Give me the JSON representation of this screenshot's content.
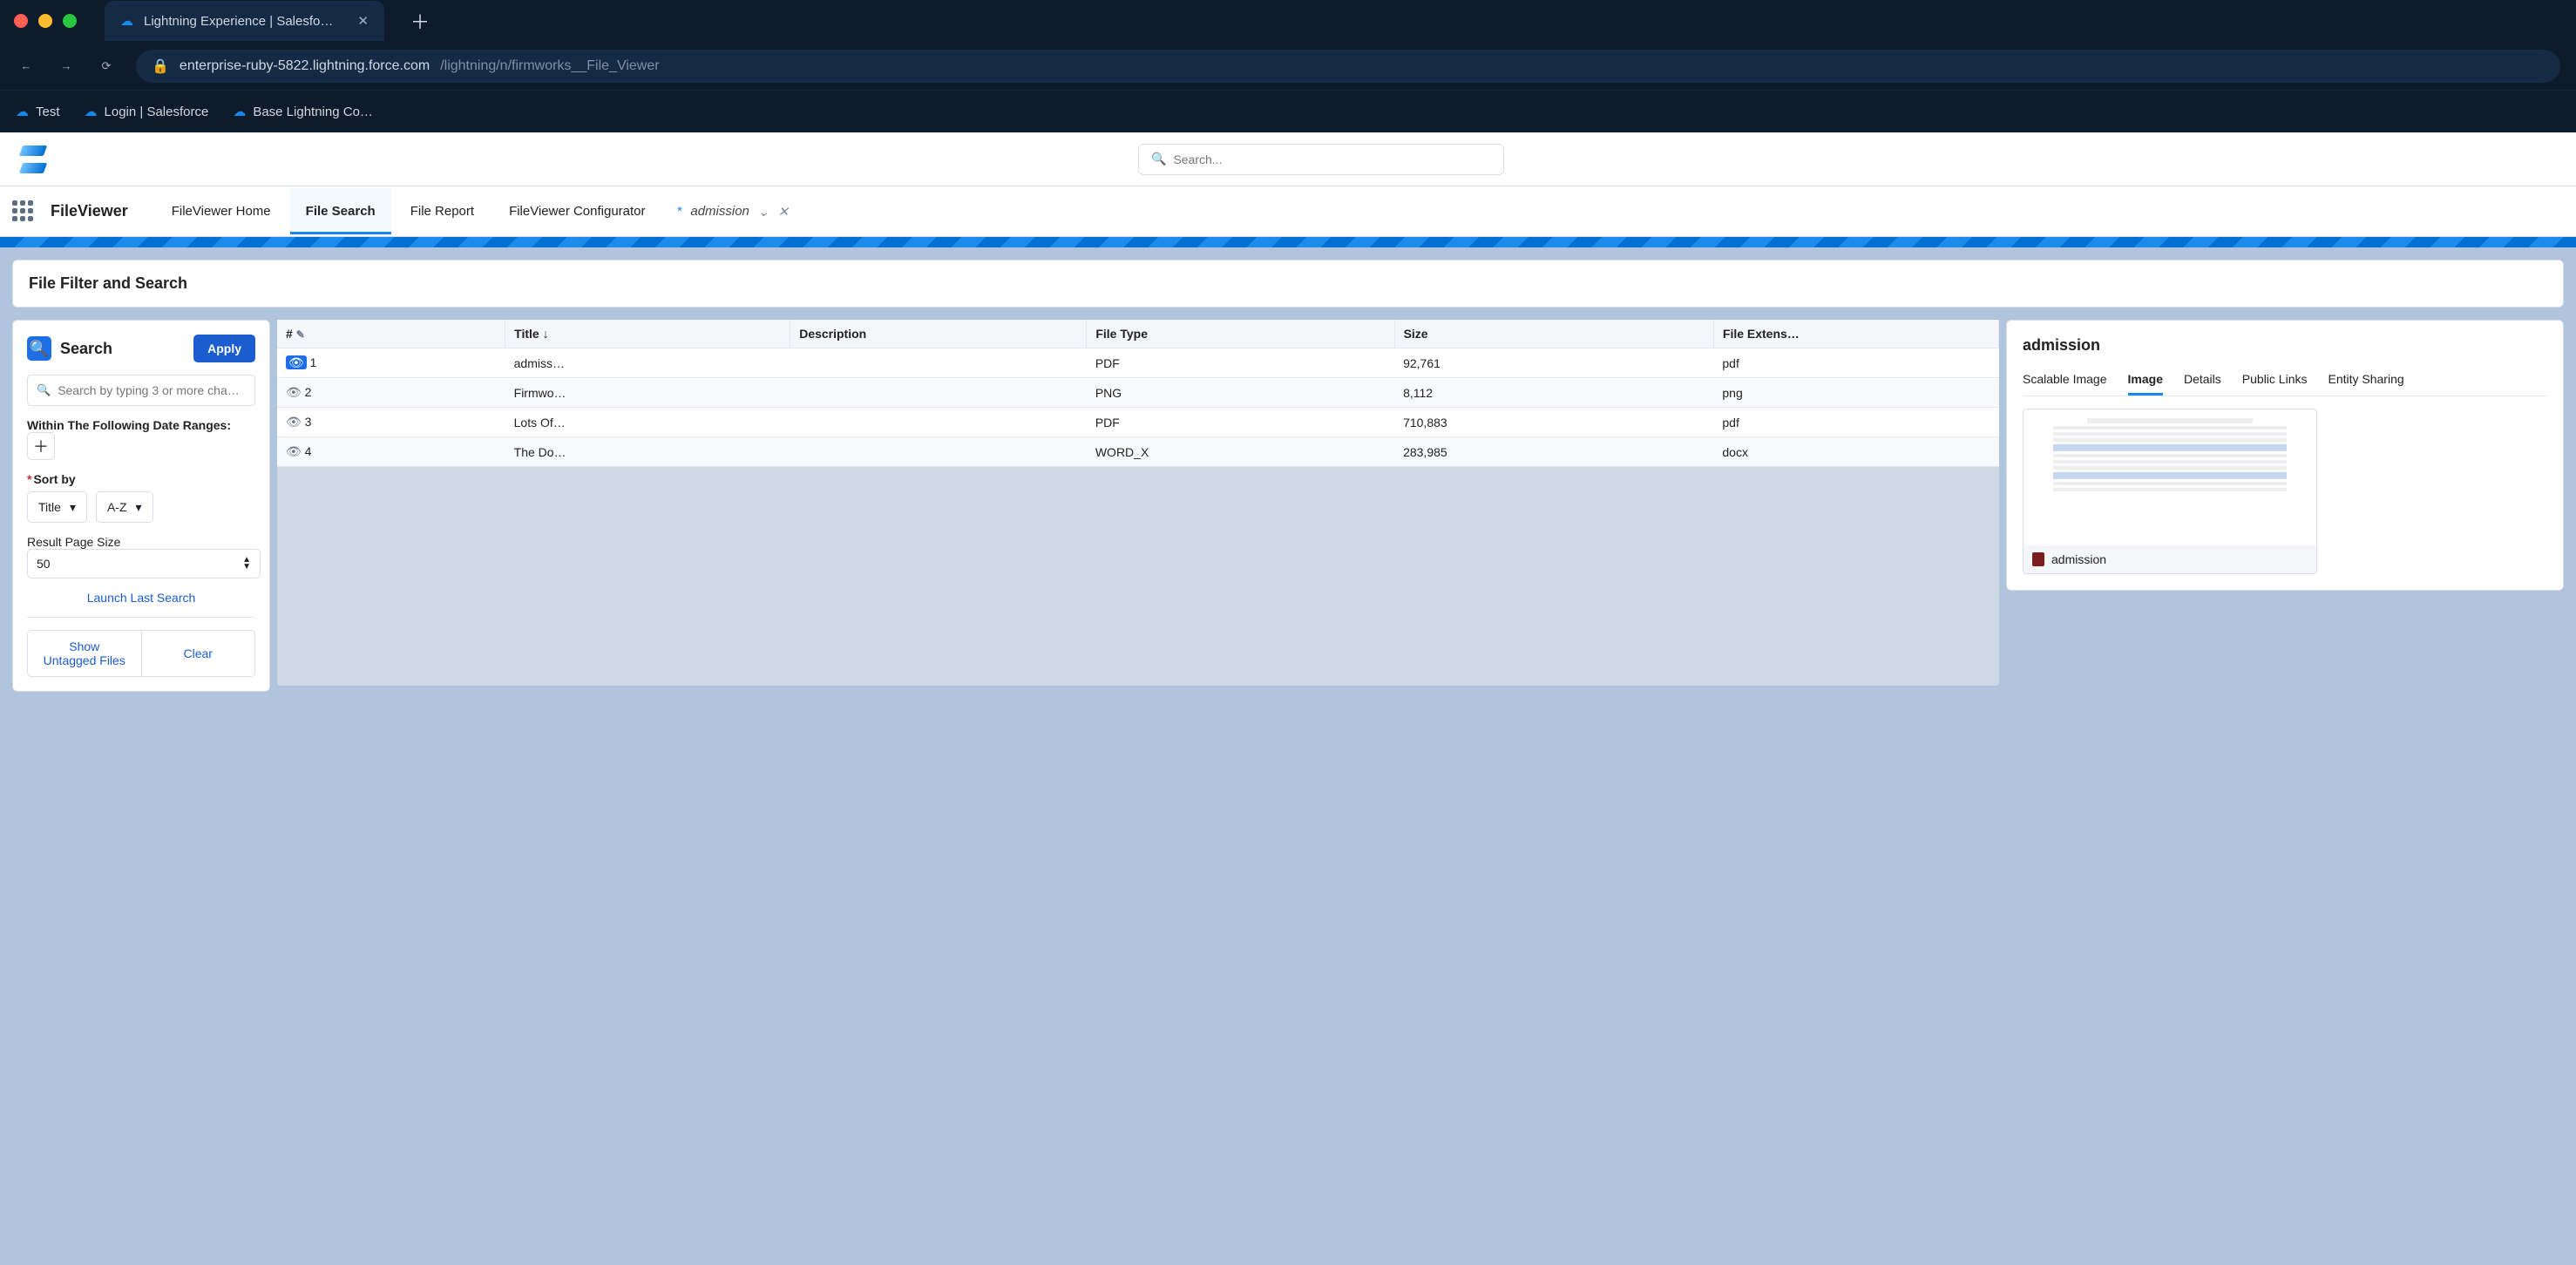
{
  "browser": {
    "tab_title": "Lightning Experience | Salesfo…",
    "url_secure": true,
    "url_host": "enterprise-ruby-5822.lightning.force.com",
    "url_path": "/lightning/n/firmworks__File_Viewer",
    "bookmarks": [
      "Test",
      "Login | Salesforce",
      "Base Lightning Co…"
    ]
  },
  "header": {
    "search_placeholder": "Search..."
  },
  "nav": {
    "context": "FileViewer",
    "items": [
      "FileViewer Home",
      "File Search",
      "File Report",
      "FileViewer Configurator"
    ],
    "active_index": 1,
    "dynamic_tab": "admission"
  },
  "page": {
    "title": "File Filter and Search"
  },
  "search": {
    "heading": "Search",
    "apply": "Apply",
    "placeholder": "Search by typing 3 or more cha…",
    "date_label": "Within The Following Date Ranges:",
    "sort_label": "Sort by",
    "sort_field": "Title",
    "sort_dir": "A-Z",
    "pagesize_label": "Result Page Size",
    "pagesize": "50",
    "launch_last": "Launch Last Search",
    "untagged": "Show Untagged Files",
    "clear": "Clear"
  },
  "table": {
    "columns": [
      "#",
      "Title",
      "Description",
      "File Type",
      "Size",
      "File Extens…"
    ],
    "sort_col": 1,
    "rows": [
      {
        "n": "1",
        "title": "admiss…",
        "desc": "",
        "ftype": "PDF",
        "size": "92,761",
        "ext": "pdf",
        "selected": true
      },
      {
        "n": "2",
        "title": "Firmwo…",
        "desc": "",
        "ftype": "PNG",
        "size": "8,112",
        "ext": "png",
        "selected": false
      },
      {
        "n": "3",
        "title": "Lots Of…",
        "desc": "",
        "ftype": "PDF",
        "size": "710,883",
        "ext": "pdf",
        "selected": false
      },
      {
        "n": "4",
        "title": "The Do…",
        "desc": "",
        "ftype": "WORD_X",
        "size": "283,985",
        "ext": "docx",
        "selected": false
      }
    ]
  },
  "preview": {
    "title": "admission",
    "tabs": [
      "Scalable Image",
      "Image",
      "Details",
      "Public Links",
      "Entity Sharing"
    ],
    "active_tab": 1,
    "caption": "admission"
  }
}
